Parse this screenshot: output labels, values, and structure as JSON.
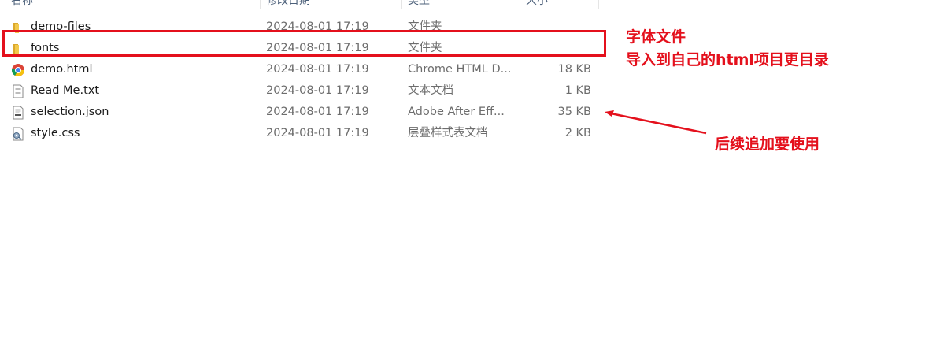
{
  "columns": {
    "name": "名称",
    "date": "修改日期",
    "type": "类型",
    "size": "大小"
  },
  "files": [
    {
      "name": "demo-files",
      "date": "2024-08-01 17:19",
      "type": "文件夹",
      "size": "",
      "icon": "folder-icon"
    },
    {
      "name": "fonts",
      "date": "2024-08-01 17:19",
      "type": "文件夹",
      "size": "",
      "icon": "folder-icon"
    },
    {
      "name": "demo.html",
      "date": "2024-08-01 17:19",
      "type": "Chrome HTML D...",
      "size": "18 KB",
      "icon": "chrome-icon"
    },
    {
      "name": "Read Me.txt",
      "date": "2024-08-01 17:19",
      "type": "文本文档",
      "size": "1 KB",
      "icon": "text-file-icon"
    },
    {
      "name": "selection.json",
      "date": "2024-08-01 17:19",
      "type": "Adobe After Eff...",
      "size": "35 KB",
      "icon": "json-file-icon"
    },
    {
      "name": "style.css",
      "date": "2024-08-01 17:19",
      "type": "层叠样式表文档",
      "size": "2 KB",
      "icon": "css-file-icon"
    }
  ],
  "annotations": {
    "fonts_line1": "字体文件",
    "fonts_line2": "导入到自己的html项目更目录",
    "json_note": "后续追加要使用"
  },
  "colors": {
    "annotation": "#e4101c",
    "folder": "#f2c94c"
  }
}
